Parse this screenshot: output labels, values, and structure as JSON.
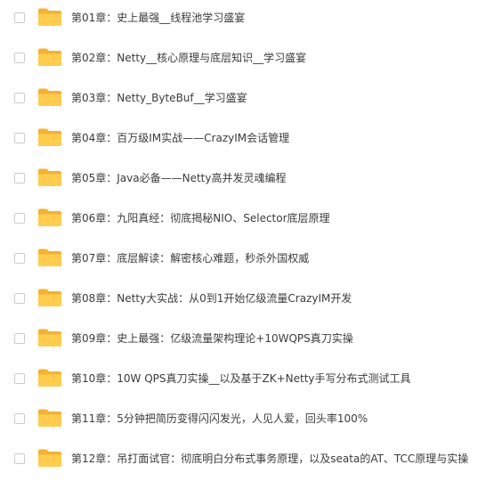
{
  "files": [
    {
      "name": "第01章：史上最强__线程池学习盛宴",
      "icon": "folder-icon"
    },
    {
      "name": "第02章：Netty__核心原理与底层知识__学习盛宴",
      "icon": "folder-icon"
    },
    {
      "name": "第03章：Netty_ByteBuf__学习盛宴",
      "icon": "folder-icon"
    },
    {
      "name": "第04章：百万级IM实战——CrazyIM会话管理",
      "icon": "folder-icon"
    },
    {
      "name": "第05章：Java必备——Netty高并发灵魂编程",
      "icon": "folder-icon"
    },
    {
      "name": "第06章：九阳真经：彻底揭秘NIO、Selector底层原理",
      "icon": "folder-icon"
    },
    {
      "name": "第07章：底层解读：解密核心难题，秒杀外国权威",
      "icon": "folder-icon"
    },
    {
      "name": "第08章：Netty大实战：从0到1开始亿级流量CrazyIM开发",
      "icon": "folder-icon"
    },
    {
      "name": "第09章：史上最强：亿级流量架构理论+10WQPS真刀实操",
      "icon": "folder-icon"
    },
    {
      "name": "第10章：10W QPS真刀实操__以及基于ZK+Netty手写分布式测试工具",
      "icon": "folder-icon"
    },
    {
      "name": "第11章：5分钟把简历变得闪闪发光，人见人爱，回头率100%",
      "icon": "folder-icon"
    },
    {
      "name": "第12章：吊打面试官：彻底明白分布式事务原理，以及seata的AT、TCC原理与实操",
      "icon": "folder-icon"
    }
  ],
  "colors": {
    "folder_back": "#F2B233",
    "folder_front": "#FFCC4D",
    "text": "#3b3b3b",
    "checkbox_border": "#c9ccd1"
  }
}
